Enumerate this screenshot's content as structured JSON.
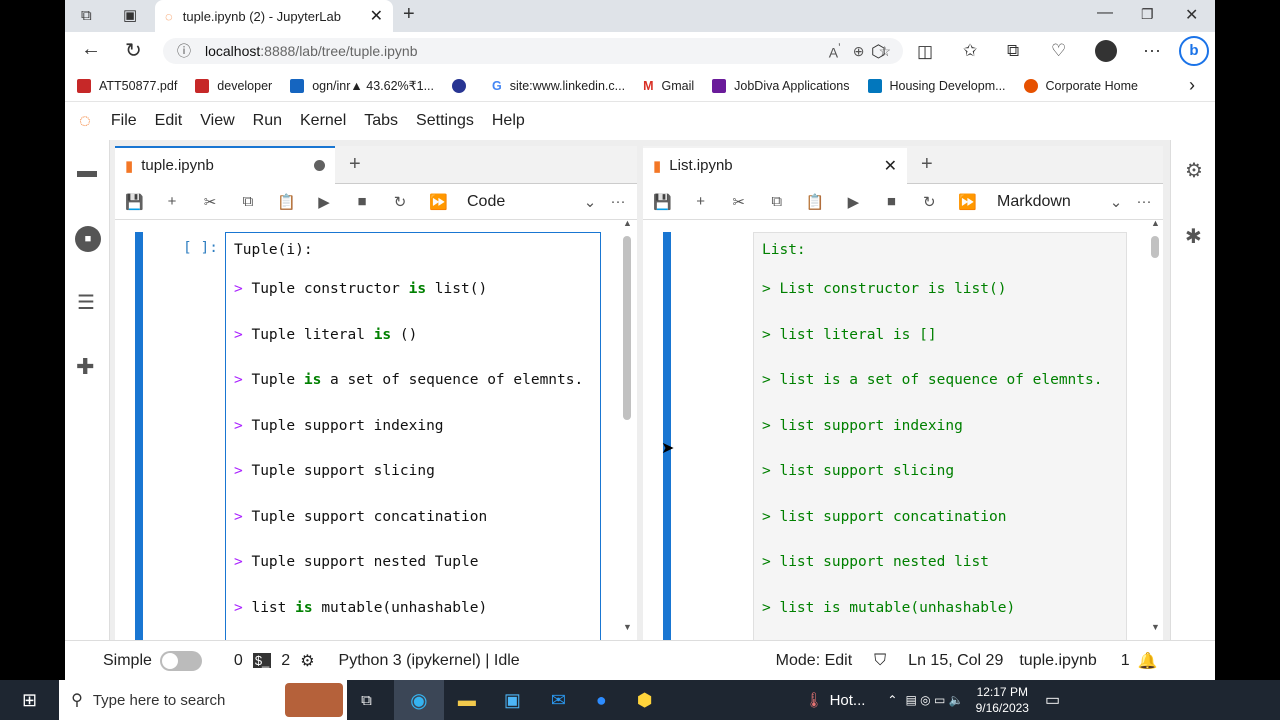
{
  "browser": {
    "tab_title": "tuple.ipynb (2) - JupyterLab",
    "url_host": "localhost",
    "url_path": ":8888/lab/tree/tuple.ipynb",
    "bookmarks": [
      {
        "label": "ATT50877.pdf",
        "color": "#c62828"
      },
      {
        "label": "developer",
        "color": "#c62828"
      },
      {
        "label": "ogn/inr▲ 43.62%₹1...",
        "color": "#1565c0"
      },
      {
        "label": "",
        "color": "#283593"
      },
      {
        "label": "site:www.linkedin.c...",
        "color": "#4285f4"
      },
      {
        "label": "Gmail",
        "color": "#d93025"
      },
      {
        "label": "JobDiva Applications",
        "color": "#6a1b9a"
      },
      {
        "label": "Housing Developm...",
        "color": "#0277bd"
      },
      {
        "label": "Corporate Home",
        "color": "#e65100"
      }
    ]
  },
  "menu": [
    "File",
    "Edit",
    "View",
    "Run",
    "Kernel",
    "Tabs",
    "Settings",
    "Help"
  ],
  "left_panel": {
    "tab": "tuple.ipynb",
    "cell_type": "Code",
    "prompt": "[ ]:",
    "lines": [
      "Tuple(i):",
      "> Tuple constructor is list()",
      "> Tuple literal is ()",
      "> Tuple is a set of sequence of elemnts.",
      "> Tuple support indexing",
      "> Tuple support slicing",
      "> Tuple support concatination",
      "> Tuple support nested Tuple",
      "> list is mutable(unhashable)"
    ]
  },
  "right_panel": {
    "tab": "List.ipynb",
    "cell_type": "Markdown",
    "lines": [
      "List:",
      "> List constructor is list()",
      "> list literal is []",
      "> list is a set of sequence of elemnts.",
      "> list support indexing",
      "> list support slicing",
      "> list support concatination",
      "> list support nested list",
      "> list is mutable(unhashable)"
    ]
  },
  "status": {
    "mode_label": "Simple",
    "count1": "0",
    "count2": "2",
    "kernel": "Python 3 (ipykernel) | Idle",
    "mode": "Mode: Edit",
    "position": "Ln 15, Col 29",
    "file": "tuple.ipynb",
    "notifications": "1"
  },
  "taskbar": {
    "search_placeholder": "Type here to search",
    "weather": "Hot...",
    "time": "12:17 PM",
    "date": "9/16/2023"
  },
  "colors": {
    "accent": "#1976d2",
    "markdown_green": "#008000"
  }
}
